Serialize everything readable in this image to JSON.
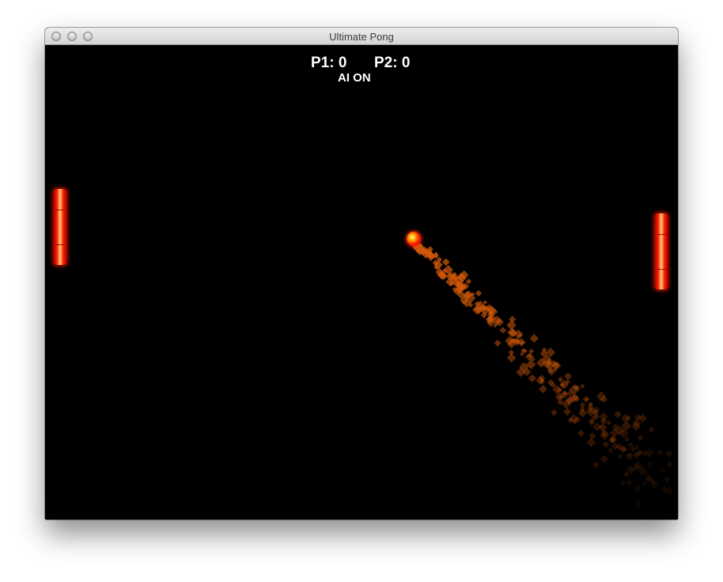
{
  "window": {
    "title": "Ultimate Pong"
  },
  "hud": {
    "p1_score": "P1: 0",
    "p2_score": "P2: 0",
    "ai_status": "AI ON"
  },
  "colors": {
    "background": "#000000",
    "paddle": "#ff1a00",
    "ball": "#ff2000",
    "trail": "#d2590a",
    "hud_text": "#ffffff"
  },
  "icons": {
    "close": "traffic-light-close-icon",
    "minimize": "traffic-light-minimize-icon",
    "zoom": "traffic-light-zoom-icon"
  }
}
